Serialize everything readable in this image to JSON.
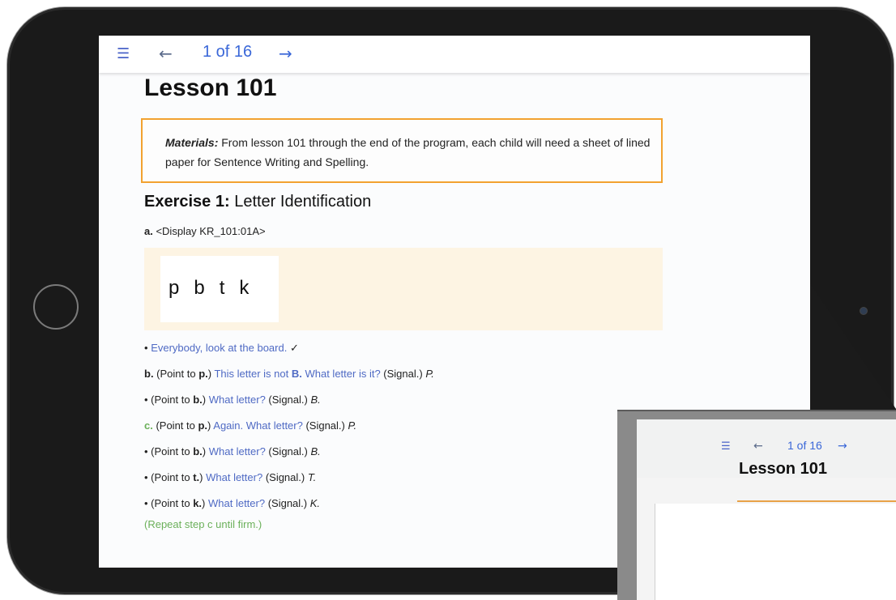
{
  "toolbar": {
    "page_indicator": "1 of 16"
  },
  "lesson": {
    "title": "Lesson 101",
    "materials_label": "Materials:",
    "materials_text": " From lesson 101 through the end of the program, each child will need a sheet of lined paper for Sentence Writing and Spelling."
  },
  "exercise": {
    "number_label": "Exercise 1:",
    "name": " Letter Identification",
    "display_label": "a.",
    "display_text": " <Display KR_101:01A>",
    "letters": [
      "p",
      "b",
      "t",
      "k"
    ]
  },
  "steps": {
    "look": {
      "bullet": "•",
      "blue": "Everybody, look at the board.",
      "mark": " ✓"
    },
    "b": {
      "label": "b.",
      "pre": " (Point to ",
      "bold": "p.",
      "post": ") ",
      "blue1": "This letter is not ",
      "bold2": "B.",
      "blue2": " What letter is it?",
      "signal": " (Signal.) ",
      "answer": "P."
    },
    "b2": {
      "bullet": "•",
      "pre": " (Point to ",
      "bold": "b.",
      "post": ") ",
      "blue": "What letter?",
      "signal": " (Signal.) ",
      "answer": "B."
    },
    "c": {
      "label": "c.",
      "pre": " (Point to ",
      "bold": "p.",
      "post": ") ",
      "blue": "Again. What letter?",
      "signal": " (Signal.) ",
      "answer": "P."
    },
    "c2": {
      "bullet": "•",
      "pre": " (Point to ",
      "bold": "b.",
      "post": ") ",
      "blue": "What letter?",
      "signal": " (Signal.) ",
      "answer": "B."
    },
    "c3": {
      "bullet": "•",
      "pre": " (Point to ",
      "bold": "t.",
      "post": ") ",
      "blue": "What letter?",
      "signal": " (Signal.) ",
      "answer": "T."
    },
    "c4": {
      "bullet": "•",
      "pre": " (Point to ",
      "bold": "k.",
      "post": ") ",
      "blue": "What letter?",
      "signal": " (Signal.) ",
      "answer": "K."
    },
    "repeat": "(Repeat step c until firm.)"
  },
  "popup": {
    "page_indicator": "1 of 16",
    "title": "Lesson 101"
  },
  "colors": {
    "accent_blue": "#3a67d8",
    "materials_border": "#f2a230",
    "display_panel": "#fdf4e3",
    "teacher_script": "#4f6ac4",
    "repeat_green": "#6bb05a"
  },
  "icons": {
    "menu": "hamburger-menu-icon",
    "back": "arrow-left-icon",
    "next": "arrow-right-icon",
    "check": "check-mark-icon"
  }
}
